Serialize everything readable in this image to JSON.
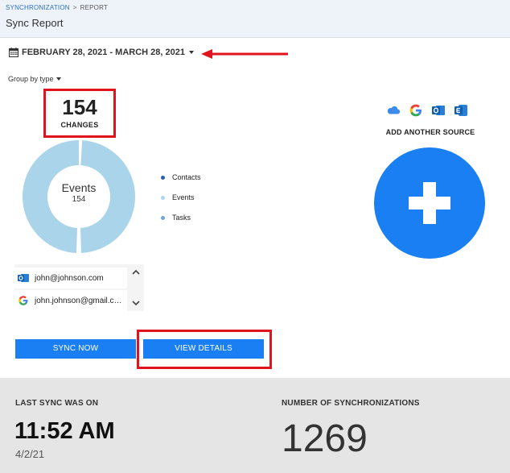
{
  "breadcrumb": {
    "parent": "SYNCHRONIZATION",
    "separator": ">",
    "current": "REPORT"
  },
  "page_title": "Sync Report",
  "date_range": {
    "label": "FEBRUARY 28, 2021 - MARCH 28, 2021"
  },
  "group_by": {
    "label": "Group by type"
  },
  "summary": {
    "changes_count": "154",
    "changes_label": "CHANGES"
  },
  "chart_data": {
    "type": "pie",
    "categories": [
      "Contacts",
      "Events",
      "Tasks"
    ],
    "values": [
      0,
      154,
      0
    ],
    "center_label": "Events",
    "center_value": "154",
    "colors": [
      "#2a5fb0",
      "#a9d4ea",
      "#6aa8d8"
    ]
  },
  "legend": [
    {
      "label": "Contacts",
      "color": "#2a5fb0"
    },
    {
      "label": "Events",
      "color": "#a9d4ea"
    },
    {
      "label": "Tasks",
      "color": "#6aa8d8"
    }
  ],
  "accounts": [
    {
      "email": "john@johnson.com",
      "icon": "outlook-icon"
    },
    {
      "email": "john.johnson@gmail.com",
      "icon": "google-icon"
    }
  ],
  "buttons": {
    "sync_now": "SYNC NOW",
    "view_details": "VIEW DETAILS"
  },
  "sources": {
    "icons": [
      "icloud-icon",
      "google-icon",
      "outlook-icon",
      "exchange-icon"
    ],
    "add_label": "ADD ANOTHER SOURCE"
  },
  "footer": {
    "last_sync_label": "LAST SYNC WAS ON",
    "last_sync_time": "11:52 AM",
    "last_sync_date": "4/2/21",
    "sync_count_label": "NUMBER OF SYNCHRONIZATIONS",
    "sync_count": "1269"
  },
  "colors": {
    "accent": "#1a7ff2",
    "highlight": "#e0141c",
    "header_bg": "#eef3fa",
    "footer_bg": "#e5e5e5"
  }
}
